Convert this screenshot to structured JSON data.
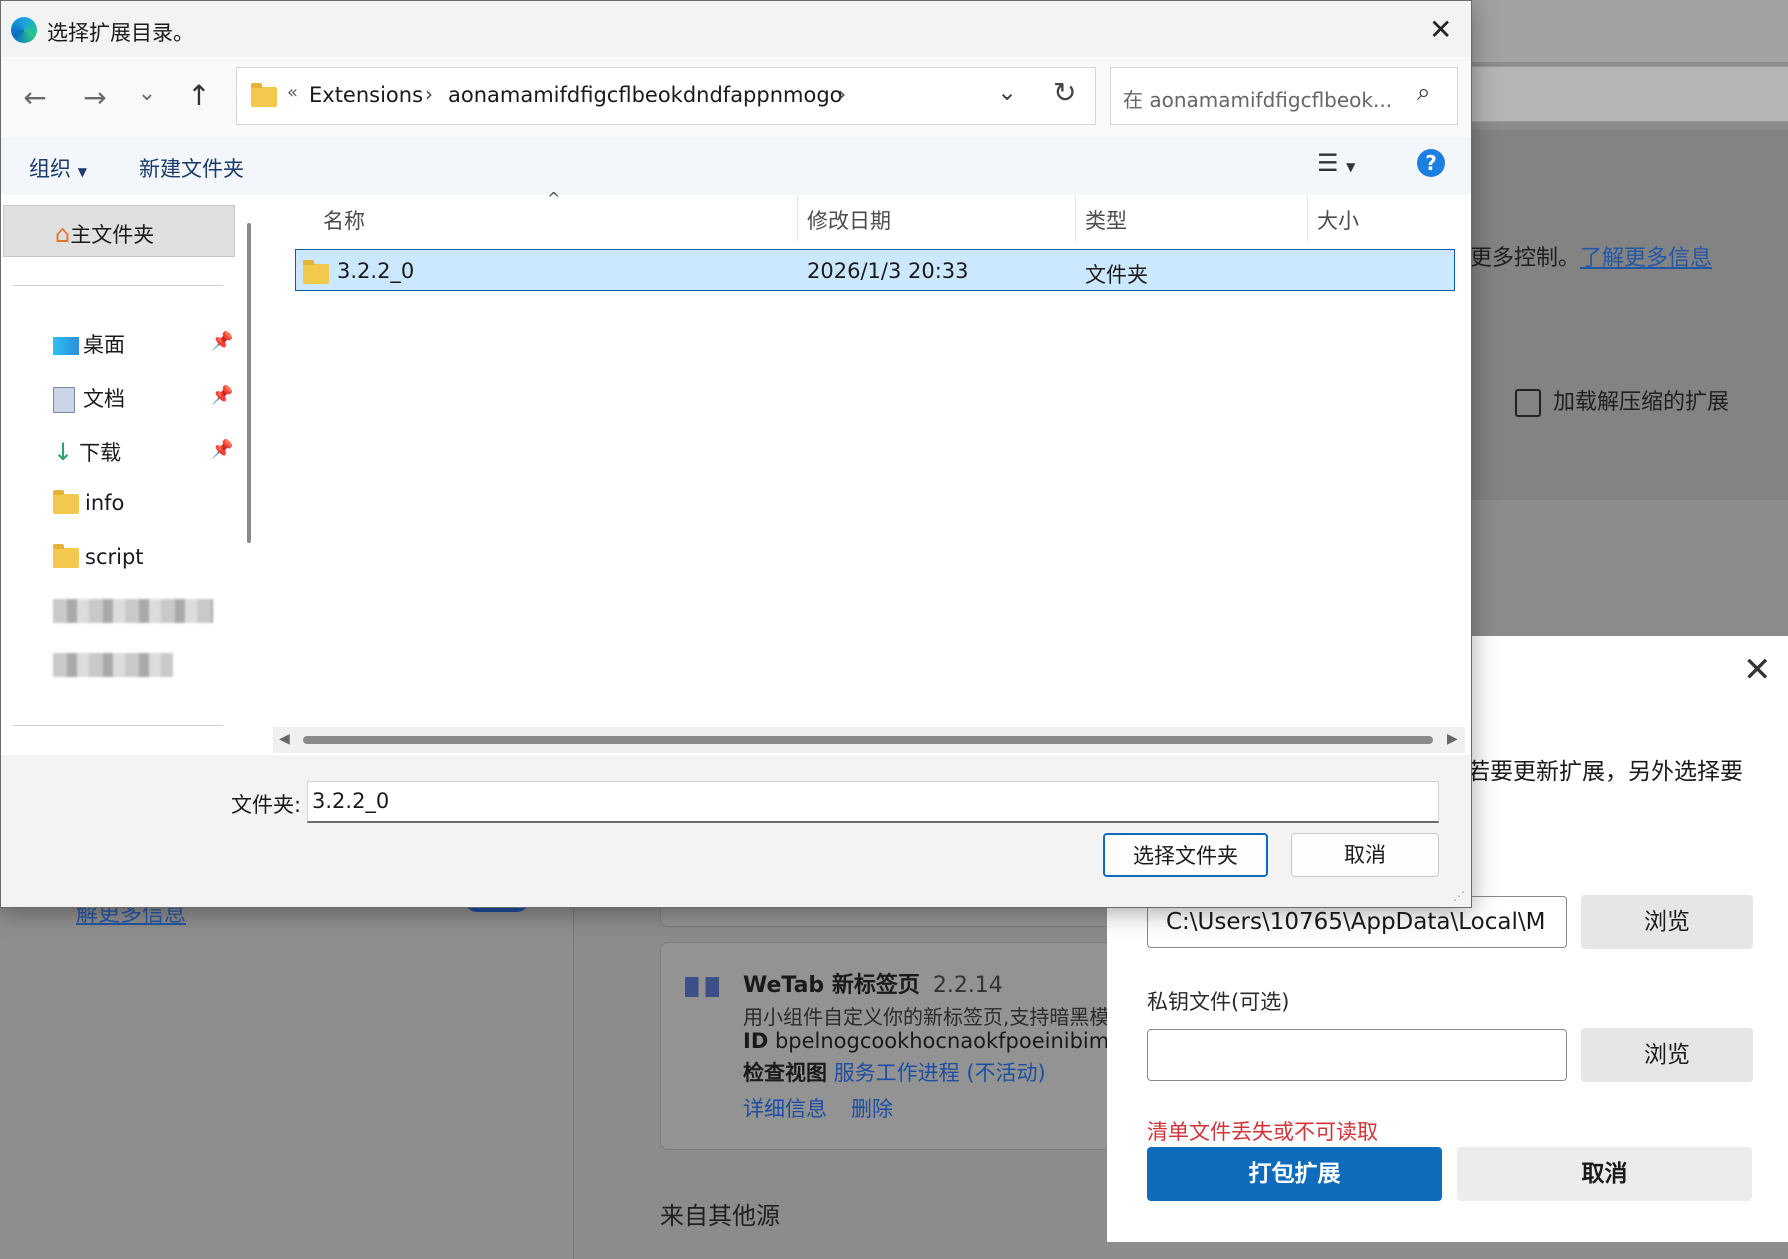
{
  "background_page": {
    "more_control_text": "更多控制。",
    "learn_more_link": "了解更多信息",
    "load_unpacked_label": "加载解压缩的扩展",
    "left_learn_more": "解更多信息",
    "extension_card": {
      "name": "WeTab 新标签页",
      "version": "2.2.14",
      "description": "用小组件自定义你的新标签页,支持暗黑模",
      "id_label": "ID",
      "id_value": "bpelnogcookhocnaokfpoeinibimb",
      "inspect_label": "检查视图",
      "inspect_link": "服务工作进程 (不活动)",
      "details_link": "详细信息",
      "remove_link": "删除"
    },
    "other_sources": "来自其他源"
  },
  "pack_dialog": {
    "partial_text": "若要更新扩展，另外选择要",
    "root_dir_value": "C:\\Users\\10765\\AppData\\Local\\M",
    "browse_label_1": "浏览",
    "private_key_label": "私钥文件(可选)",
    "private_key_value": "",
    "browse_label_2": "浏览",
    "error_text": "清单文件丢失或不可读取",
    "pack_button": "打包扩展",
    "cancel_button": "取消"
  },
  "file_dialog": {
    "title": "选择扩展目录。",
    "breadcrumb": [
      "Extensions",
      "aonamamifdfigcflbeokdndfappnmogo"
    ],
    "breadcrumb_prefix": "«",
    "search_placeholder": "在 aonamamifdfigcflbeok...",
    "organize_label": "组织",
    "new_folder_label": "新建文件夹",
    "help_label": "?",
    "sidebar": {
      "home": "主文件夹",
      "items": [
        "桌面",
        "文档",
        "下载",
        "info",
        "script"
      ]
    },
    "columns": {
      "name": "名称",
      "modified": "修改日期",
      "type": "类型",
      "size": "大小"
    },
    "rows": [
      {
        "name": "3.2.2_0",
        "modified": "2026/1/3 20:33",
        "type": "文件夹",
        "size": ""
      }
    ],
    "folder_label": "文件夹:",
    "folder_value": "3.2.2_0",
    "select_button": "选择文件夹",
    "cancel_button": "取消"
  },
  "colors": {
    "accent": "#0f6cbd",
    "selection": "#cce8ff",
    "error": "#d13438",
    "link": "#2457a5"
  }
}
